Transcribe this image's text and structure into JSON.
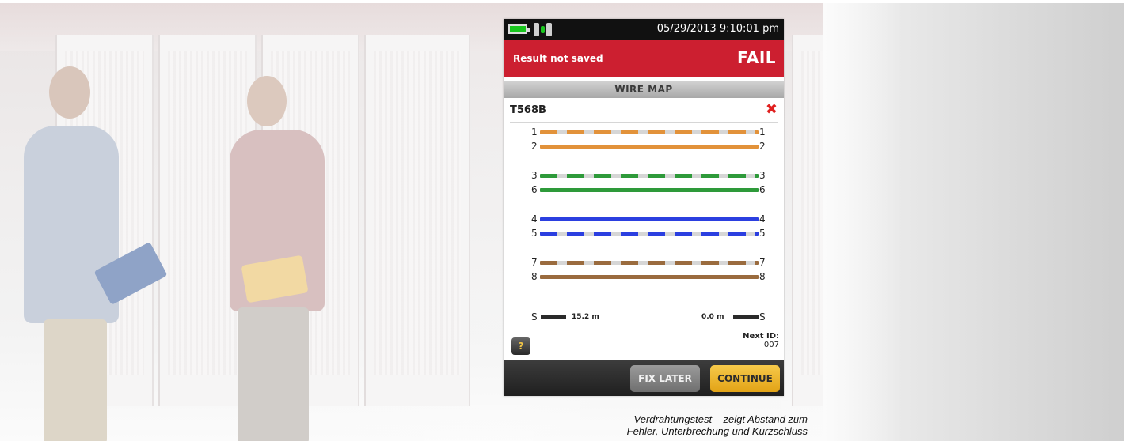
{
  "device": {
    "datetime": "05/29/2013 9:10:01 pm",
    "result_status": "Result not saved",
    "result": "FAIL",
    "section_title": "WIRE MAP",
    "standard": "T568B",
    "fail_mark": "✖",
    "wires": [
      {
        "left_pin": "1",
        "right_pin": "1",
        "color": "#e2923a",
        "striped": true
      },
      {
        "left_pin": "2",
        "right_pin": "2",
        "color": "#e2923a",
        "striped": false
      },
      {
        "left_pin": "3",
        "right_pin": "3",
        "color": "#2e9a3a",
        "striped": true
      },
      {
        "left_pin": "6",
        "right_pin": "6",
        "color": "#2e9a3a",
        "striped": false
      },
      {
        "left_pin": "4",
        "right_pin": "4",
        "color": "#2b3fe0",
        "striped": false
      },
      {
        "left_pin": "5",
        "right_pin": "5",
        "color": "#2b3fe0",
        "striped": true
      },
      {
        "left_pin": "7",
        "right_pin": "7",
        "color": "#9a6b3e",
        "striped": true
      },
      {
        "left_pin": "8",
        "right_pin": "8",
        "color": "#9a6b3e",
        "striped": false
      }
    ],
    "shield": {
      "left_label": "S",
      "right_label": "S",
      "left_distance": "15.2 m",
      "right_distance": "0.0 m"
    },
    "help_label": "?",
    "next_id_label": "Next ID:",
    "next_id_value": "007",
    "buttons": {
      "fix_later": "FIX LATER",
      "continue": "CONTINUE"
    }
  },
  "caption": {
    "line1": "Verdrahtungstest – zeigt Abstand zum",
    "line2": "Fehler, Unterbrechung und Kurzschluss"
  },
  "icons": [
    "battery-icon",
    "link-status-icon",
    "fail-x-icon",
    "help-icon"
  ],
  "colors": {
    "fail_bar": "#cc1f30",
    "continue_button": "#f2bb38",
    "battery": "#19c61e"
  }
}
